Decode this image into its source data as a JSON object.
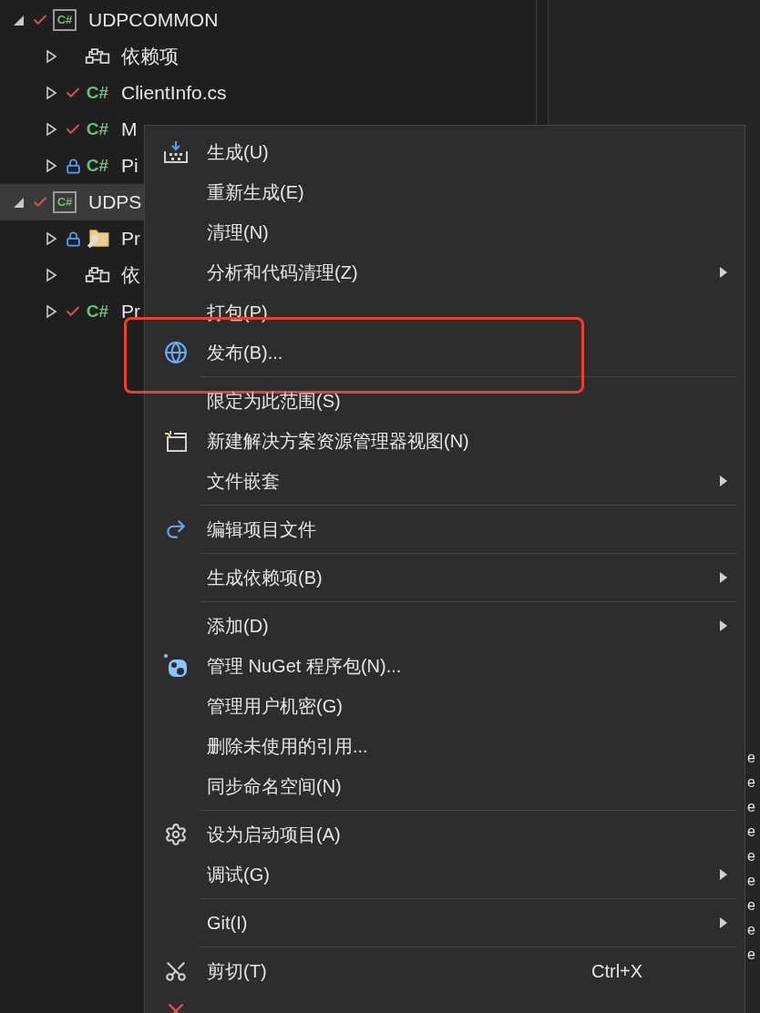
{
  "tree": [
    {
      "kind": "project",
      "label": "UDPCOMMON",
      "icon_label": "C#",
      "checked_in": true,
      "locked": false,
      "expanded": true,
      "selected": false,
      "children": [
        {
          "kind": "dependencies",
          "label": "依赖项",
          "checked_in": false,
          "locked": false,
          "expanded": false,
          "selected": false
        },
        {
          "kind": "file",
          "label": "ClientInfo.cs",
          "icon_label": "C#",
          "checked_in": true,
          "locked": false,
          "expanded": false,
          "selected": false
        },
        {
          "kind": "file",
          "label": "M",
          "icon_label": "C#",
          "checked_in": true,
          "locked": false,
          "expanded": false,
          "selected": false
        },
        {
          "kind": "file",
          "label": "Pi",
          "icon_label": "C#",
          "checked_in": false,
          "locked": true,
          "expanded": false,
          "selected": false
        }
      ]
    },
    {
      "kind": "project",
      "label": "UDPS",
      "icon_label": "C#",
      "checked_in": true,
      "locked": false,
      "expanded": true,
      "selected": true,
      "children": [
        {
          "kind": "properties",
          "label": "Pr",
          "checked_in": false,
          "locked": true,
          "expanded": false,
          "selected": false
        },
        {
          "kind": "dependencies",
          "label": "依",
          "checked_in": false,
          "locked": false,
          "expanded": false,
          "selected": false
        },
        {
          "kind": "file",
          "label": "Pr",
          "icon_label": "C#",
          "checked_in": true,
          "locked": false,
          "expanded": false,
          "selected": false
        }
      ]
    }
  ],
  "side_panel": {
    "rows": [
      "e",
      "e",
      "e",
      "e",
      "e",
      "e",
      "e",
      "e",
      "e"
    ]
  },
  "context_menu": [
    {
      "kind": "build",
      "label": "生成(U)",
      "submenu": false
    },
    {
      "kind": "plain",
      "label": "重新生成(E)",
      "submenu": false
    },
    {
      "kind": "plain",
      "label": "清理(N)",
      "submenu": false
    },
    {
      "kind": "plain",
      "label": "分析和代码清理(Z)",
      "submenu": true
    },
    {
      "kind": "plain",
      "label": "打包(P)",
      "submenu": false
    },
    {
      "kind": "globe",
      "label": "发布(B)...",
      "submenu": false,
      "highlighted": true
    },
    {
      "kind": "separator"
    },
    {
      "kind": "plain",
      "label": "限定为此范围(S)",
      "submenu": false
    },
    {
      "kind": "window",
      "label": "新建解决方案资源管理器视图(N)",
      "submenu": false
    },
    {
      "kind": "plain",
      "label": "文件嵌套",
      "submenu": true
    },
    {
      "kind": "separator"
    },
    {
      "kind": "redo",
      "label": "编辑项目文件",
      "submenu": false
    },
    {
      "kind": "separator"
    },
    {
      "kind": "plain",
      "label": "生成依赖项(B)",
      "submenu": true
    },
    {
      "kind": "separator"
    },
    {
      "kind": "plain",
      "label": "添加(D)",
      "submenu": true
    },
    {
      "kind": "nuget",
      "label": "管理 NuGet 程序包(N)...",
      "submenu": false
    },
    {
      "kind": "plain",
      "label": "管理用户机密(G)",
      "submenu": false
    },
    {
      "kind": "plain",
      "label": "删除未使用的引用...",
      "submenu": false
    },
    {
      "kind": "plain",
      "label": "同步命名空间(N)",
      "submenu": false
    },
    {
      "kind": "separator"
    },
    {
      "kind": "gear",
      "label": "设为启动项目(A)",
      "submenu": false
    },
    {
      "kind": "plain",
      "label": "调试(G)",
      "submenu": true
    },
    {
      "kind": "separator"
    },
    {
      "kind": "plain",
      "label": "Git(I)",
      "submenu": true
    },
    {
      "kind": "separator"
    },
    {
      "kind": "scissors",
      "label": "剪切(T)",
      "shortcut": "Ctrl+X",
      "submenu": false
    },
    {
      "kind": "cross",
      "submenu": false
    }
  ]
}
